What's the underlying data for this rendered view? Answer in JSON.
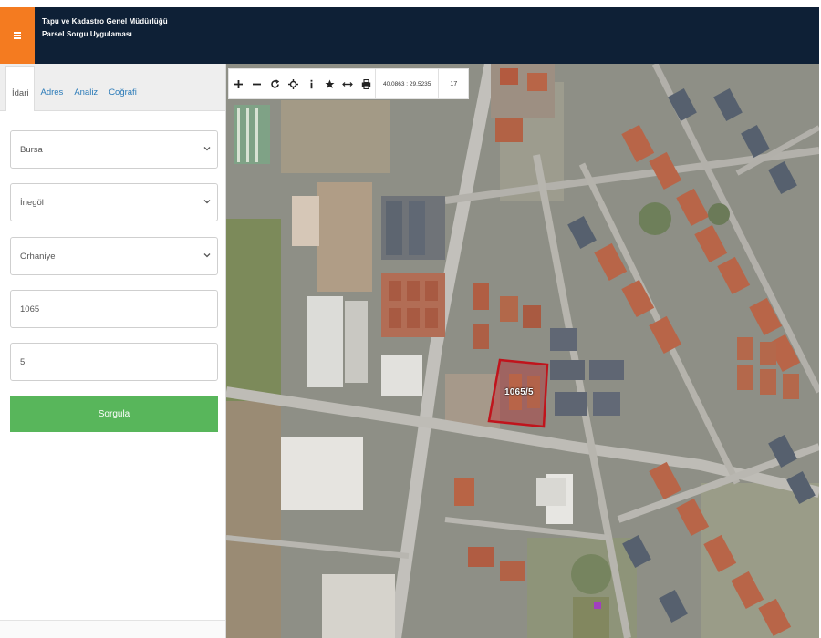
{
  "header": {
    "title_line1": "Tapu ve Kadastro Genel Müdürlüğü",
    "title_line2": "Parsel Sorgu Uygulaması",
    "menu_icon": "hamburger-icon",
    "accent_color": "#f47b20",
    "bar_color": "#0e2036"
  },
  "sidebar": {
    "tabs": [
      {
        "label": "İdari"
      },
      {
        "label": "Adres"
      },
      {
        "label": "Analiz"
      },
      {
        "label": "Coğrafi"
      }
    ],
    "fields": {
      "il": {
        "value": "Bursa"
      },
      "ilce": {
        "value": "İnegöl"
      },
      "mahalle": {
        "value": "Orhaniye"
      },
      "ada": {
        "value": "1065"
      },
      "parsel": {
        "value": "5"
      }
    },
    "submit_label": "Sorgula",
    "submit_color": "#58b65b"
  },
  "map": {
    "toolbar": {
      "icons": [
        "zoom-in-icon",
        "zoom-out-icon",
        "refresh-icon",
        "location-icon",
        "info-icon",
        "star-icon",
        "measure-icon",
        "print-icon"
      ],
      "coordinates": "40.0863 : 29.5235",
      "zoom_level": "17"
    },
    "parcel_label": "1065/5",
    "parcel_color": "#c0141c"
  }
}
